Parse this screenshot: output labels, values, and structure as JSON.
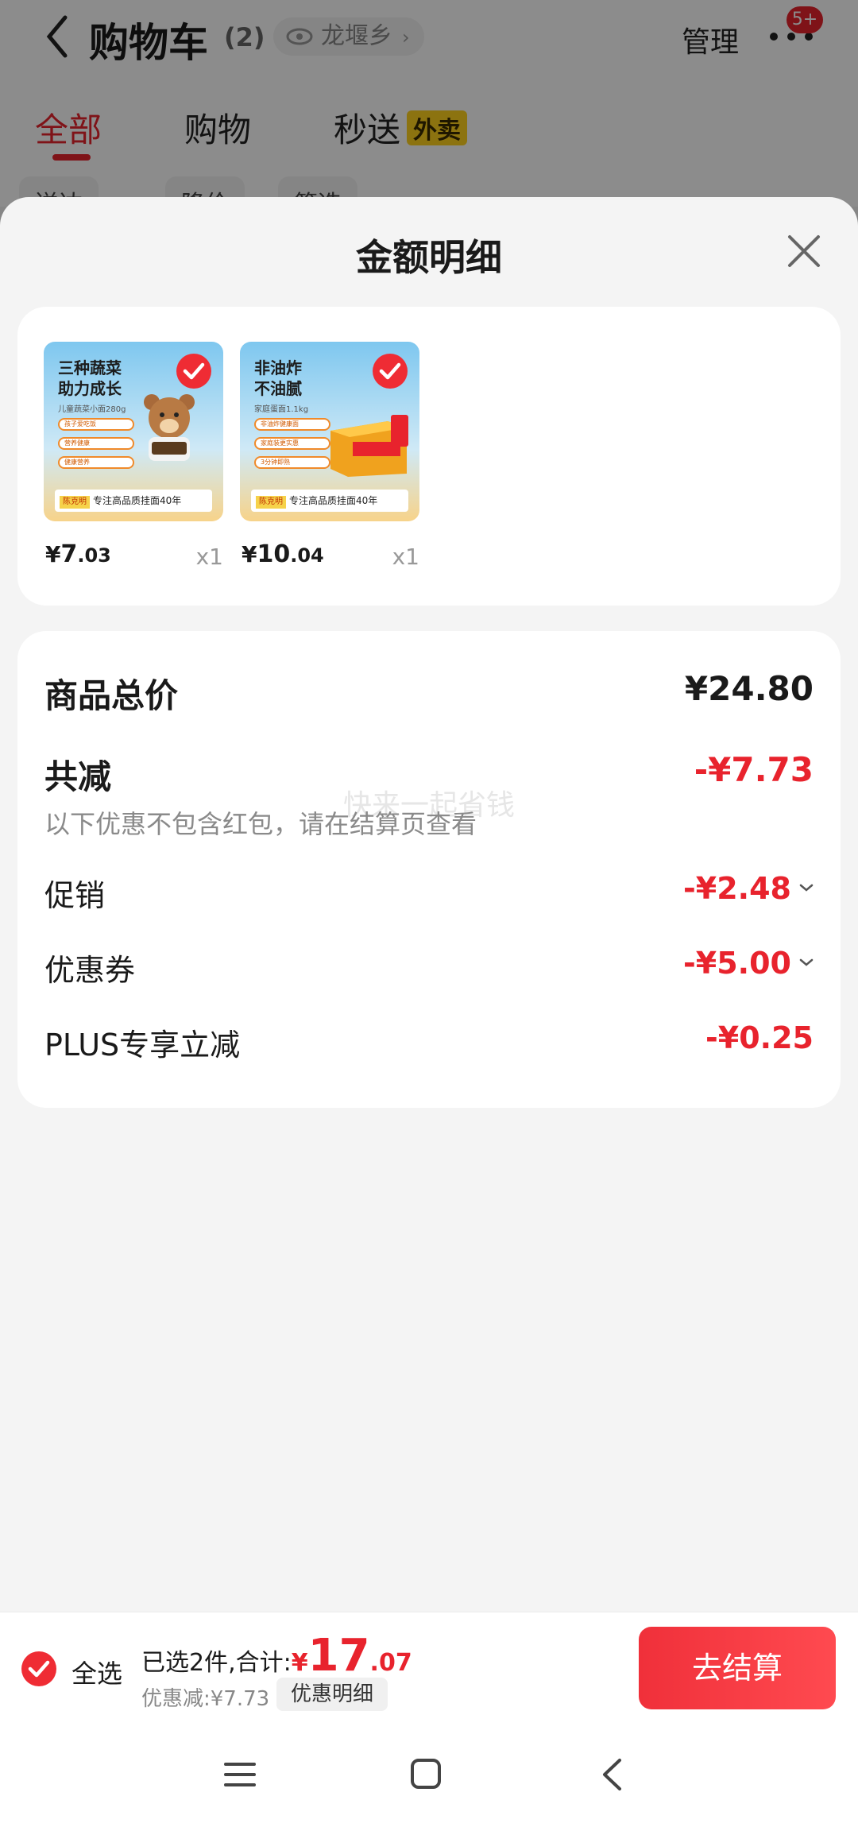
{
  "background": {
    "title": "购物车",
    "count": "(2)",
    "location": "龙堰乡",
    "manage": "管理",
    "badge": "5+",
    "tabs": [
      "全部",
      "购物",
      "秒送"
    ],
    "waimai_badge": "外卖",
    "chips": [
      "送达",
      "降价",
      "筛选"
    ]
  },
  "sheet": {
    "title": "金额明细",
    "products": [
      {
        "thumb_title": "三种蔬菜\n助力成长",
        "thumb_sub": "儿童蔬菜小面280g",
        "thumb_bullets": [
          "孩子爱吃饭",
          "营养健康",
          "健康营养"
        ],
        "thumb_brand": "陈克明",
        "thumb_footer": "专注高品质挂面40年",
        "price_int": "7",
        "price_dec": ".03",
        "qty": "x1"
      },
      {
        "thumb_title": "非油炸\n不油腻",
        "thumb_sub": "家庭蛋面1.1kg",
        "thumb_bullets": [
          "非油炸健康面",
          "家庭装更实惠",
          "3分钟即熟"
        ],
        "thumb_brand": "陈克明",
        "thumb_footer": "专注高品质挂面40年",
        "price_int": "10",
        "price_dec": ".04",
        "qty": "x1"
      }
    ],
    "summary": {
      "total_label": "商品总价",
      "total_value": "¥24.80",
      "reduce_label": "共减",
      "reduce_value": "-¥7.73",
      "note": "以下优惠不包含红包，请在结算页查看",
      "watermark": "快来一起省钱",
      "promo_label": "促销",
      "promo_value": "-¥2.48",
      "coupon_label": "优惠券",
      "coupon_value": "-¥5.00",
      "plus_label": "PLUS专享立减",
      "plus_value": "-¥0.25"
    }
  },
  "checkout": {
    "select_all": "全选",
    "selected_text": "已选2件,合计:",
    "currency": "¥",
    "total_int": "17",
    "total_dec": ".07",
    "discount_text": "优惠减:¥7.73",
    "detail_button": "优惠明细",
    "checkout_button": "去结算"
  },
  "colors": {
    "accent_red": "#e8232d",
    "waimai_yellow": "#ffd21e"
  },
  "icons": {
    "back": "chevron-left-icon",
    "eye": "eye-icon",
    "more": "more-dots-icon",
    "close": "close-icon",
    "check": "check-circle-icon",
    "chevron_down": "chevron-down-icon",
    "nav_menu": "menu-icon",
    "nav_home": "home-square-icon",
    "nav_back": "nav-back-icon"
  }
}
